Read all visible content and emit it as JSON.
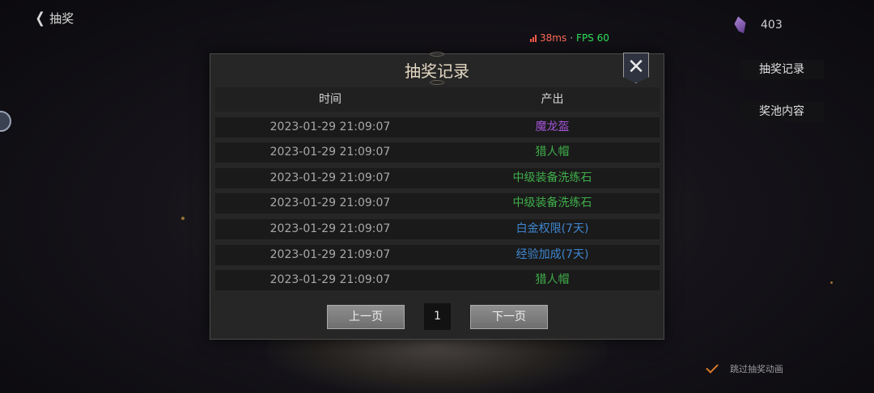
{
  "header": {
    "back_label": "抽奖"
  },
  "stats": {
    "ping": "38ms",
    "separator": "·",
    "fps": "FPS 60"
  },
  "currency": {
    "icon": "gem-icon",
    "amount": "403"
  },
  "side_buttons": [
    "抽奖记录",
    "奖池内容"
  ],
  "skip": {
    "label": "跳过抽奖动画",
    "checked": true
  },
  "modal": {
    "title": "抽奖记录",
    "close_label": "✕",
    "columns": [
      "时间",
      "产出"
    ],
    "rows": [
      {
        "time": "2023-01-29 21:09:07",
        "item": "魔龙盔",
        "color": "#a454d8"
      },
      {
        "time": "2023-01-29 21:09:07",
        "item": "猎人帽",
        "color": "#3fae4a"
      },
      {
        "time": "2023-01-29 21:09:07",
        "item": "中级装备洗练石",
        "color": "#3fae4a"
      },
      {
        "time": "2023-01-29 21:09:07",
        "item": "中级装备洗练石",
        "color": "#3fae4a"
      },
      {
        "time": "2023-01-29 21:09:07",
        "item": "白金权限(7天)",
        "color": "#3f86d0"
      },
      {
        "time": "2023-01-29 21:09:07",
        "item": "经验加成(7天)",
        "color": "#3f86d0"
      },
      {
        "time": "2023-01-29 21:09:07",
        "item": "猎人帽",
        "color": "#3fae4a"
      }
    ],
    "pager": {
      "prev": "上一页",
      "page": "1",
      "next": "下一页"
    }
  }
}
